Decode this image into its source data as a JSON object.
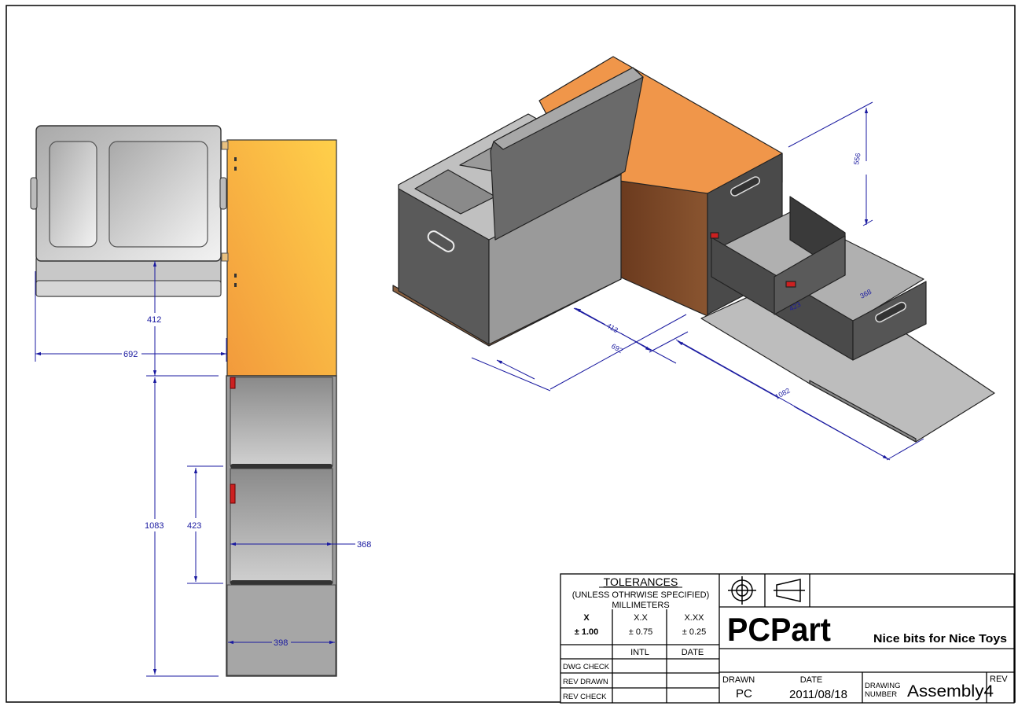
{
  "dimensions": {
    "left_view": {
      "width_overall": "692",
      "depth_box": "412",
      "length_drawer": "1083",
      "drawer_depth": "423",
      "drawer_width": "368",
      "base_width": "398"
    },
    "iso_view": {
      "height": "556",
      "box_depth": "413",
      "box_width": "692",
      "length": "1082",
      "drawer_depth": "423",
      "drawer_width": "368"
    }
  },
  "title_block": {
    "tolerances_heading": "TOLERANCES",
    "unless_note": "(UNLESS OTHRWISE SPECIFIED)",
    "units": "MILLIMETERS",
    "tol_headers": [
      "X",
      "X.X",
      "X.XX"
    ],
    "tol_values": [
      "± 1.00",
      "± 0.75",
      "± 0.25"
    ],
    "col_intl": "INTL",
    "col_date": "DATE",
    "check_rows": [
      "DWG CHECK",
      "REV DRAWN",
      "REV CHECK"
    ],
    "company": "PCPart",
    "slogan": "Nice bits for Nice Toys",
    "drawn_label": "DRAWN",
    "drawn_value": "PC",
    "date_label": "DATE",
    "date_value": "2011/08/18",
    "drawing_label_1": "DRAWING",
    "drawing_label_2": "NUMBER",
    "drawing_number": "Assembly4",
    "rev_label": "REV",
    "projection_symbol": "first-angle-projection-icon",
    "target_symbol": "crosshair-target-icon"
  },
  "colors": {
    "dimension_blue": "#1a1aa0",
    "orange_panel": "#f5a44a",
    "dark_panel": "#5a5a5a",
    "grey_panel": "#b8b8b8",
    "wood_brown": "#7a4a2a",
    "latch_red": "#cc2020"
  }
}
